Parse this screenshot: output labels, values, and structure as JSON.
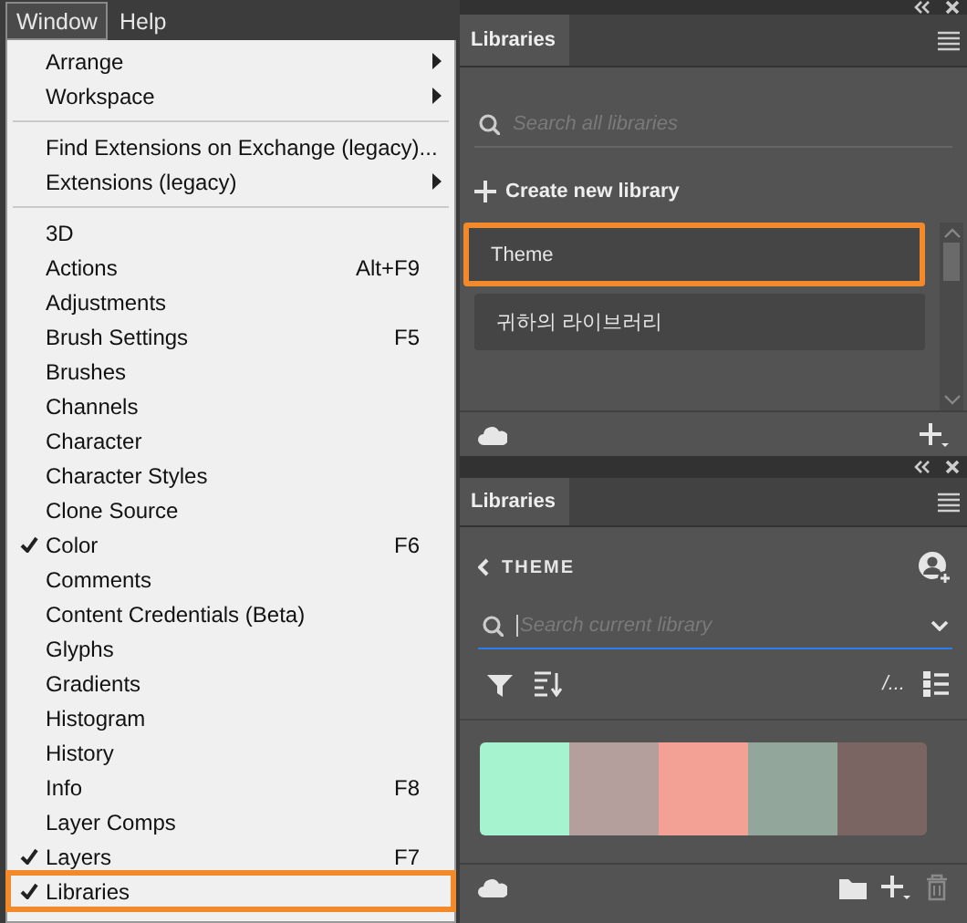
{
  "menubar": [
    {
      "label": "Window",
      "selected": true
    },
    {
      "label": "Help",
      "selected": false
    }
  ],
  "menu": [
    {
      "kind": "item",
      "label": "Arrange",
      "checked": false,
      "submenu": true,
      "outlined": false
    },
    {
      "kind": "item",
      "label": "Workspace",
      "checked": false,
      "submenu": true,
      "outlined": false
    },
    {
      "kind": "separator"
    },
    {
      "kind": "item",
      "label": "Find Extensions on Exchange (legacy)...",
      "checked": false,
      "submenu": false,
      "outlined": false
    },
    {
      "kind": "item",
      "label": "Extensions (legacy)",
      "checked": false,
      "submenu": true,
      "outlined": false
    },
    {
      "kind": "separator"
    },
    {
      "kind": "item",
      "label": "3D",
      "checked": false,
      "submenu": false,
      "outlined": false
    },
    {
      "kind": "item",
      "label": "Actions",
      "shortcut": "Alt+F9",
      "checked": false,
      "submenu": false,
      "outlined": false
    },
    {
      "kind": "item",
      "label": "Adjustments",
      "checked": false,
      "submenu": false,
      "outlined": false
    },
    {
      "kind": "item",
      "label": "Brush Settings",
      "shortcut": "F5",
      "checked": false,
      "submenu": false,
      "outlined": false
    },
    {
      "kind": "item",
      "label": "Brushes",
      "checked": false,
      "submenu": false,
      "outlined": false
    },
    {
      "kind": "item",
      "label": "Channels",
      "checked": false,
      "submenu": false,
      "outlined": false
    },
    {
      "kind": "item",
      "label": "Character",
      "checked": false,
      "submenu": false,
      "outlined": false
    },
    {
      "kind": "item",
      "label": "Character Styles",
      "checked": false,
      "submenu": false,
      "outlined": false
    },
    {
      "kind": "item",
      "label": "Clone Source",
      "checked": false,
      "submenu": false,
      "outlined": false
    },
    {
      "kind": "item",
      "label": "Color",
      "shortcut": "F6",
      "checked": true,
      "submenu": false,
      "outlined": false
    },
    {
      "kind": "item",
      "label": "Comments",
      "checked": false,
      "submenu": false,
      "outlined": false
    },
    {
      "kind": "item",
      "label": "Content Credentials (Beta)",
      "checked": false,
      "submenu": false,
      "outlined": false
    },
    {
      "kind": "item",
      "label": "Glyphs",
      "checked": false,
      "submenu": false,
      "outlined": false
    },
    {
      "kind": "item",
      "label": "Gradients",
      "checked": false,
      "submenu": false,
      "outlined": false
    },
    {
      "kind": "item",
      "label": "Histogram",
      "checked": false,
      "submenu": false,
      "outlined": false
    },
    {
      "kind": "item",
      "label": "History",
      "checked": false,
      "submenu": false,
      "outlined": false
    },
    {
      "kind": "item",
      "label": "Info",
      "shortcut": "F8",
      "checked": false,
      "submenu": false,
      "outlined": false
    },
    {
      "kind": "item",
      "label": "Layer Comps",
      "checked": false,
      "submenu": false,
      "outlined": false
    },
    {
      "kind": "item",
      "label": "Layers",
      "shortcut": "F7",
      "checked": true,
      "submenu": false,
      "outlined": false
    },
    {
      "kind": "item",
      "label": "Libraries",
      "checked": true,
      "submenu": false,
      "outlined": true
    }
  ],
  "libraries_panel": {
    "tab": "Libraries",
    "search": {
      "placeholder": "Search all libraries"
    },
    "create_button": "Create new library",
    "libraries": [
      {
        "name": "Theme",
        "outlined": true
      },
      {
        "name": "귀하의 라이브러리",
        "outlined": false
      }
    ]
  },
  "theme_panel": {
    "tab": "Libraries",
    "back_label": "THEME",
    "search": {
      "placeholder": "Search current library"
    },
    "view_label": "/...",
    "swatches": [
      {
        "color": "#a6f3cf"
      },
      {
        "color": "#b49f9c"
      },
      {
        "color": "#f4a195"
      },
      {
        "color": "#92a69b"
      },
      {
        "color": "#7a6563"
      }
    ]
  }
}
